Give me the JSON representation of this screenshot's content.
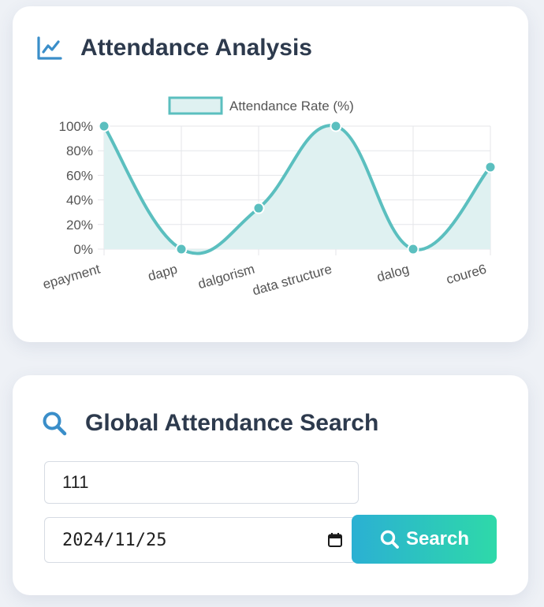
{
  "chart_card": {
    "title": "Attendance Analysis",
    "icon": "line-chart-icon"
  },
  "chart_data": {
    "type": "line",
    "categories": [
      "epayment",
      "dapp",
      "dalgorism",
      "data structure",
      "dalog",
      "coure6"
    ],
    "series": [
      {
        "name": "Attendance Rate (%)",
        "values": [
          100,
          0,
          33.3,
          100,
          0,
          66.7
        ]
      }
    ],
    "y_ticks": [
      "0%",
      "20%",
      "40%",
      "60%",
      "80%",
      "100%"
    ],
    "ylim": [
      0,
      100
    ],
    "grid": true,
    "legend": "top-center",
    "fill": true,
    "smooth": true,
    "colors": {
      "line": "#5bbfbf",
      "fill": "#dff1f1",
      "grid": "#e4e6ea",
      "tick_text": "#555555"
    }
  },
  "search_card": {
    "title": "Global Attendance Search",
    "icon": "search-icon",
    "keyword_value": "111",
    "date_value": "2024/11/25",
    "date_icon": "calendar-icon",
    "search_label": "Search",
    "search_icon": "search-icon",
    "colors": {
      "accent": "#3a8ec9",
      "button_start": "#2bb0d3",
      "button_end": "#2ed9a9"
    }
  }
}
